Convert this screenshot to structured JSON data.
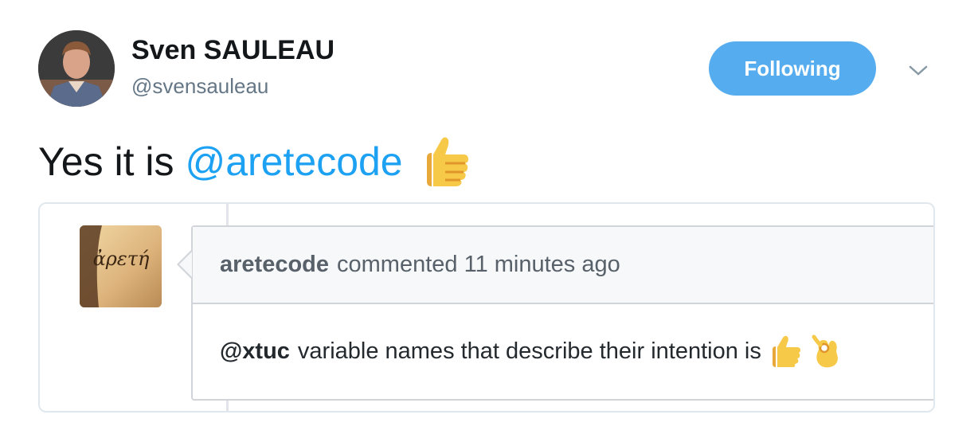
{
  "author": {
    "display_name": "Sven SAULEAU",
    "handle": "@svensauleau"
  },
  "header": {
    "follow_label": "Following"
  },
  "tweet": {
    "text_prefix": "Yes it is",
    "mention": "@aretecode",
    "emoji": "thumbs-up"
  },
  "quote_card": {
    "avatar_text": "ἀρετή",
    "comment_author": "aretecode",
    "comment_meta": "commented 11 minutes ago",
    "body_mention": "@xtuc",
    "body_text": "variable names that describe their intention is",
    "body_emojis": [
      "thumbs-up",
      "ok-hand"
    ]
  },
  "colors": {
    "follow_button": "#55acee",
    "mention": "#1da1f2",
    "handle": "#657786"
  }
}
